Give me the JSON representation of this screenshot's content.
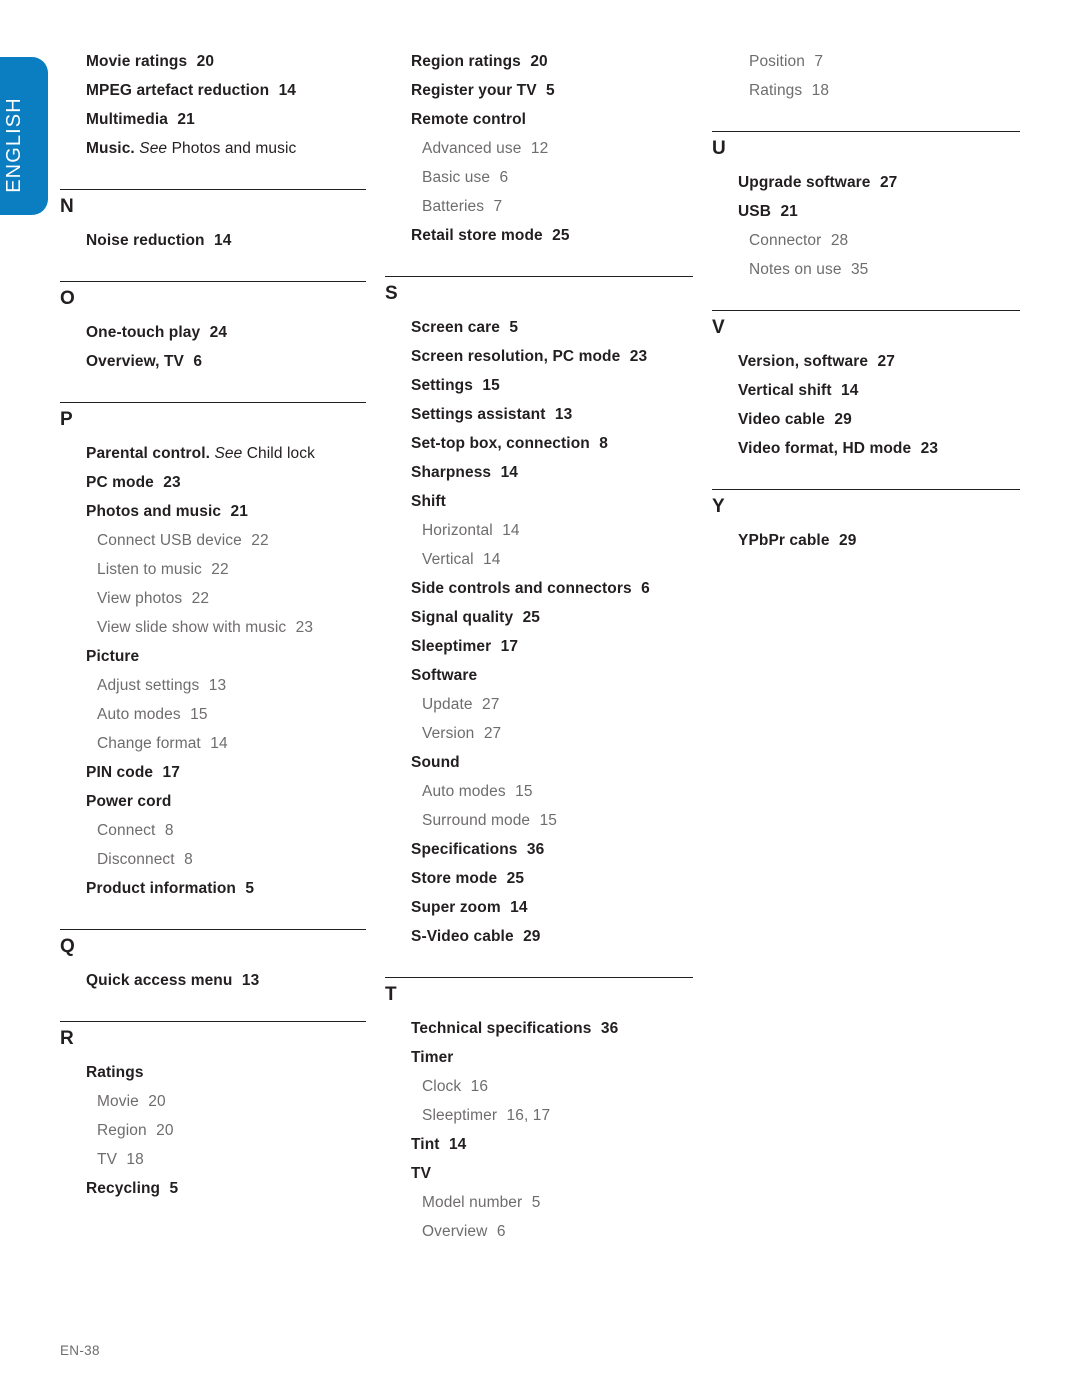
{
  "language_tab": {
    "label": "ENGLISH",
    "color": "#0b7ec2"
  },
  "footer": {
    "page_label": "EN-38"
  },
  "colors": {
    "entry_main": "#231f20",
    "entry_sub": "#6f6c6e",
    "rule": "#231f20"
  },
  "columns": [
    {
      "id": "col-1",
      "groups": [
        {
          "letter": null,
          "rule": false,
          "entries": [
            {
              "level": 1,
              "text": "Movie ratings",
              "page": "20"
            },
            {
              "level": 1,
              "text": "MPEG artefact reduction",
              "page": "14"
            },
            {
              "level": 1,
              "text": "Multimedia",
              "page": "21"
            },
            {
              "level": 1,
              "text": "Music.",
              "see": "See",
              "after": "Photos and music",
              "page": ""
            }
          ]
        },
        {
          "letter": "N",
          "rule": true,
          "entries": [
            {
              "level": 1,
              "text": "Noise reduction",
              "page": "14"
            }
          ]
        },
        {
          "letter": "O",
          "rule": true,
          "entries": [
            {
              "level": 1,
              "text": "One-touch play",
              "page": "24"
            },
            {
              "level": 1,
              "text": "Overview, TV",
              "page": "6"
            }
          ]
        },
        {
          "letter": "P",
          "rule": true,
          "entries": [
            {
              "level": 1,
              "text": "Parental control.",
              "see": "See",
              "after": "Child lock",
              "page": ""
            },
            {
              "level": 1,
              "text": "PC mode",
              "page": "23"
            },
            {
              "level": 1,
              "text": "Photos and music",
              "page": "21"
            },
            {
              "level": 2,
              "text": "Connect USB device",
              "page": "22"
            },
            {
              "level": 2,
              "text": "Listen to music",
              "page": "22"
            },
            {
              "level": 2,
              "text": "View photos",
              "page": "22"
            },
            {
              "level": 2,
              "text": "View slide show with music",
              "page": "23"
            },
            {
              "level": 1,
              "text": "Picture",
              "page": ""
            },
            {
              "level": 2,
              "text": "Adjust settings",
              "page": "13"
            },
            {
              "level": 2,
              "text": "Auto modes",
              "page": "15"
            },
            {
              "level": 2,
              "text": "Change format",
              "page": "14"
            },
            {
              "level": 1,
              "text": "PIN code",
              "page": "17"
            },
            {
              "level": 1,
              "text": "Power cord",
              "page": ""
            },
            {
              "level": 2,
              "text": "Connect",
              "page": "8"
            },
            {
              "level": 2,
              "text": "Disconnect",
              "page": "8"
            },
            {
              "level": 1,
              "text": "Product information",
              "page": "5"
            }
          ]
        },
        {
          "letter": "Q",
          "rule": true,
          "entries": [
            {
              "level": 1,
              "text": "Quick access menu",
              "page": "13"
            }
          ]
        },
        {
          "letter": "R",
          "rule": true,
          "entries": [
            {
              "level": 1,
              "text": "Ratings",
              "page": ""
            },
            {
              "level": 2,
              "text": "Movie",
              "page": "20"
            },
            {
              "level": 2,
              "text": "Region",
              "page": "20"
            },
            {
              "level": 2,
              "text": "TV",
              "page": "18"
            },
            {
              "level": 1,
              "text": "Recycling",
              "page": "5"
            }
          ]
        }
      ]
    },
    {
      "id": "col-2",
      "groups": [
        {
          "letter": null,
          "rule": false,
          "entries": [
            {
              "level": 1,
              "text": "Region ratings",
              "page": "20"
            },
            {
              "level": 1,
              "text": "Register your TV",
              "page": "5"
            },
            {
              "level": 1,
              "text": "Remote control",
              "page": ""
            },
            {
              "level": 2,
              "text": "Advanced use",
              "page": "12"
            },
            {
              "level": 2,
              "text": "Basic use",
              "page": "6"
            },
            {
              "level": 2,
              "text": "Batteries",
              "page": "7"
            },
            {
              "level": 1,
              "text": "Retail store mode",
              "page": "25"
            }
          ]
        },
        {
          "letter": "S",
          "rule": true,
          "entries": [
            {
              "level": 1,
              "text": "Screen care",
              "page": "5"
            },
            {
              "level": 1,
              "text": "Screen resolution, PC mode",
              "page": "23"
            },
            {
              "level": 1,
              "text": "Settings",
              "page": "15"
            },
            {
              "level": 1,
              "text": "Settings assistant",
              "page": "13"
            },
            {
              "level": 1,
              "text": "Set-top box, connection",
              "page": "8"
            },
            {
              "level": 1,
              "text": "Sharpness",
              "page": "14"
            },
            {
              "level": 1,
              "text": "Shift",
              "page": ""
            },
            {
              "level": 2,
              "text": "Horizontal",
              "page": "14"
            },
            {
              "level": 2,
              "text": "Vertical",
              "page": "14"
            },
            {
              "level": 1,
              "text": "Side controls and connectors",
              "page": "6"
            },
            {
              "level": 1,
              "text": "Signal quality",
              "page": "25"
            },
            {
              "level": 1,
              "text": "Sleeptimer",
              "page": "17"
            },
            {
              "level": 1,
              "text": "Software",
              "page": ""
            },
            {
              "level": 2,
              "text": "Update",
              "page": "27"
            },
            {
              "level": 2,
              "text": "Version",
              "page": "27"
            },
            {
              "level": 1,
              "text": "Sound",
              "page": ""
            },
            {
              "level": 2,
              "text": "Auto modes",
              "page": "15"
            },
            {
              "level": 2,
              "text": "Surround mode",
              "page": "15"
            },
            {
              "level": 1,
              "text": "Specifications",
              "page": "36"
            },
            {
              "level": 1,
              "text": "Store mode",
              "page": "25"
            },
            {
              "level": 1,
              "text": "Super zoom",
              "page": "14"
            },
            {
              "level": 1,
              "text": "S-Video cable",
              "page": "29"
            }
          ]
        },
        {
          "letter": "T",
          "rule": true,
          "entries": [
            {
              "level": 1,
              "text": "Technical specifications",
              "page": "36"
            },
            {
              "level": 1,
              "text": "Timer",
              "page": ""
            },
            {
              "level": 2,
              "text": "Clock",
              "page": "16"
            },
            {
              "level": 2,
              "text": "Sleeptimer",
              "page": "16, 17"
            },
            {
              "level": 1,
              "text": "Tint",
              "page": "14"
            },
            {
              "level": 1,
              "text": "TV",
              "page": ""
            },
            {
              "level": 2,
              "text": "Model number",
              "page": "5"
            },
            {
              "level": 2,
              "text": "Overview",
              "page": "6"
            }
          ]
        }
      ]
    },
    {
      "id": "col-3",
      "groups": [
        {
          "letter": null,
          "rule": false,
          "entries": [
            {
              "level": 2,
              "text": "Position",
              "page": "7"
            },
            {
              "level": 2,
              "text": "Ratings",
              "page": "18"
            }
          ]
        },
        {
          "letter": "U",
          "rule": true,
          "entries": [
            {
              "level": 1,
              "text": "Upgrade software",
              "page": "27"
            },
            {
              "level": 1,
              "text": "USB",
              "page": "21"
            },
            {
              "level": 2,
              "text": "Connector",
              "page": "28"
            },
            {
              "level": 2,
              "text": "Notes on use",
              "page": "35"
            }
          ]
        },
        {
          "letter": "V",
          "rule": true,
          "entries": [
            {
              "level": 1,
              "text": "Version, software",
              "page": "27"
            },
            {
              "level": 1,
              "text": "Vertical shift",
              "page": "14"
            },
            {
              "level": 1,
              "text": "Video cable",
              "page": "29"
            },
            {
              "level": 1,
              "text": "Video format, HD mode",
              "page": "23"
            }
          ]
        },
        {
          "letter": "Y",
          "rule": true,
          "entries": [
            {
              "level": 1,
              "text": "YPbPr cable",
              "page": "29"
            }
          ]
        }
      ]
    }
  ]
}
